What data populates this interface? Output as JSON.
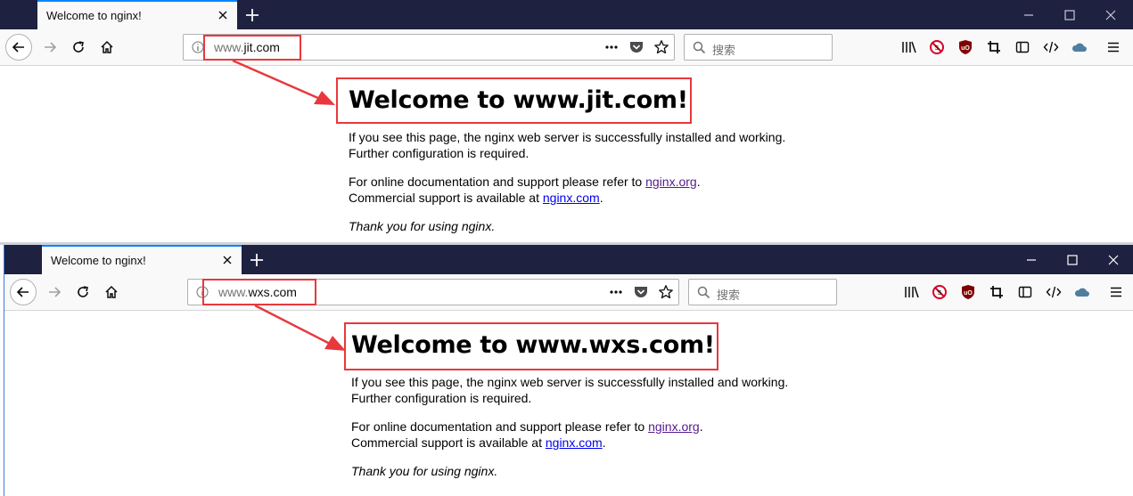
{
  "windows": [
    {
      "tab_title": "Welcome to nginx!",
      "url_prefix": "www.",
      "url_host": "jit.com",
      "search_placeholder": "搜索",
      "heading": "Welcome to www.jit.com!",
      "p1_line1": "If you see this page, the nginx web server is successfully installed and working.",
      "p1_line2": "Further configuration is required.",
      "p2_line1_before": "For online documentation and support please refer to ",
      "p2_link1": "nginx.org",
      "p2_line1_after": ".",
      "p2_line2_before": "Commercial support is available at ",
      "p2_link2": "nginx.com",
      "p2_line2_after": ".",
      "thanks": "Thank you for using nginx."
    },
    {
      "tab_title": "Welcome to nginx!",
      "url_prefix": "www.",
      "url_host": "wxs.com",
      "search_placeholder": "搜索",
      "heading": "Welcome to www.wxs.com!",
      "p1_line1": "If you see this page, the nginx web server is successfully installed and working.",
      "p1_line2": "Further configuration is required.",
      "p2_line1_before": "For online documentation and support please refer to ",
      "p2_link1": "nginx.org",
      "p2_line1_after": ".",
      "p2_line2_before": "Commercial support is available at ",
      "p2_link2": "nginx.com",
      "p2_line2_after": ".",
      "thanks": "Thank you for using nginx."
    }
  ],
  "colors": {
    "titlebar": "#1e2140",
    "tab_accent": "#0a84ff",
    "annotation": "#e8383d",
    "visited_link": "#551a8b",
    "link": "#0000ee"
  }
}
